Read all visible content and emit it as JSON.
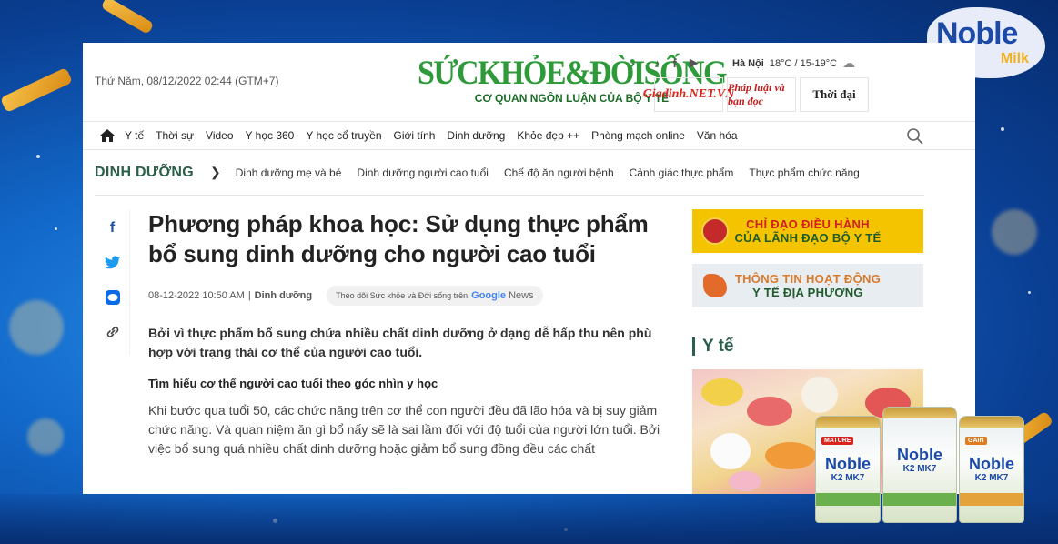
{
  "brand_corner": {
    "name": "Noble",
    "sub": "Milk"
  },
  "header": {
    "date": "Thứ Năm, 08/12/2022 02:44 (GTM+7)",
    "logo_main": "SỨCKHỎE&ĐỜISỐNG",
    "logo_sub": "CƠ QUAN NGÔN LUẬN CỦA BỘ Y TẾ",
    "social_icons": [
      "tiktok-icon",
      "facebook-icon",
      "youtube-icon"
    ],
    "weather_city": "Hà Nội",
    "weather_temp": "18°C / 15-19°C",
    "partners": [
      "Giadinh.NET.VN",
      "Pháp luật và bạn đọc",
      "Thời đại"
    ]
  },
  "nav": {
    "items": [
      "Y tế",
      "Thời sự",
      "Video",
      "Y học 360",
      "Y học cổ truyền",
      "Giới tính",
      "Dinh dưỡng",
      "Khỏe đẹp ++",
      "Phòng mạch online",
      "Văn hóa"
    ]
  },
  "subnav": {
    "category": "DINH DƯỠNG",
    "items": [
      "Dinh dưỡng mẹ và bé",
      "Dinh dưỡng người cao tuổi",
      "Chế độ ăn người bệnh",
      "Cảnh giác thực phẩm",
      "Thực phẩm chức năng"
    ]
  },
  "article": {
    "title": "Phương pháp khoa học: Sử dụng thực phẩm bổ sung dinh dưỡng cho người cao tuổi",
    "date": "08-12-2022 10:50 AM",
    "category": "Dinh dưỡng",
    "follow_text": "Theo dõi Sức khỏe và Đời sống trên",
    "follow_brand": "Google",
    "follow_news": "News",
    "lead": "Bởi vì thực phẩm bổ sung chứa nhiều chất dinh dưỡng ở dạng dễ hấp thu nên phù hợp với trạng thái cơ thể của người cao tuổi.",
    "subheading": "Tìm hiểu cơ thể người cao tuổi theo góc nhìn y học",
    "body": "Khi bước qua tuổi 50, các chức năng trên cơ thể con người đều đã lão hóa và bị suy giảm chức năng. Và quan niệm ăn gì bổ nấy sẽ là sai lầm đối với độ tuổi của người lớn tuổi. Bởi việc bổ sung quá nhiều chất dinh dưỡng hoặc giảm bổ sung đồng đều các chất"
  },
  "sidebar": {
    "banner1_line1": "CHỈ ĐẠO ĐIỀU HÀNH",
    "banner1_line2": "CỦA LÃNH ĐẠO BỘ Y TẾ",
    "banner2_line1": "THÔNG TIN HOẠT ĐỘNG",
    "banner2_line2": "Y TẾ ĐỊA PHƯƠNG",
    "section_title": "Y tế"
  },
  "products": {
    "cans": [
      {
        "tag": "MATURE",
        "name": "Noble",
        "sub": "K2 MK7"
      },
      {
        "tag": "",
        "name": "Noble",
        "sub": "K2 MK7"
      },
      {
        "tag": "GAIN",
        "name": "Noble",
        "sub": "K2 MK7"
      }
    ]
  },
  "colors": {
    "accent_green": "#2c5f4a",
    "logo_green": "#2e9a3a",
    "banner_yellow": "#f5c400",
    "bg_blue": "#1268c9"
  }
}
